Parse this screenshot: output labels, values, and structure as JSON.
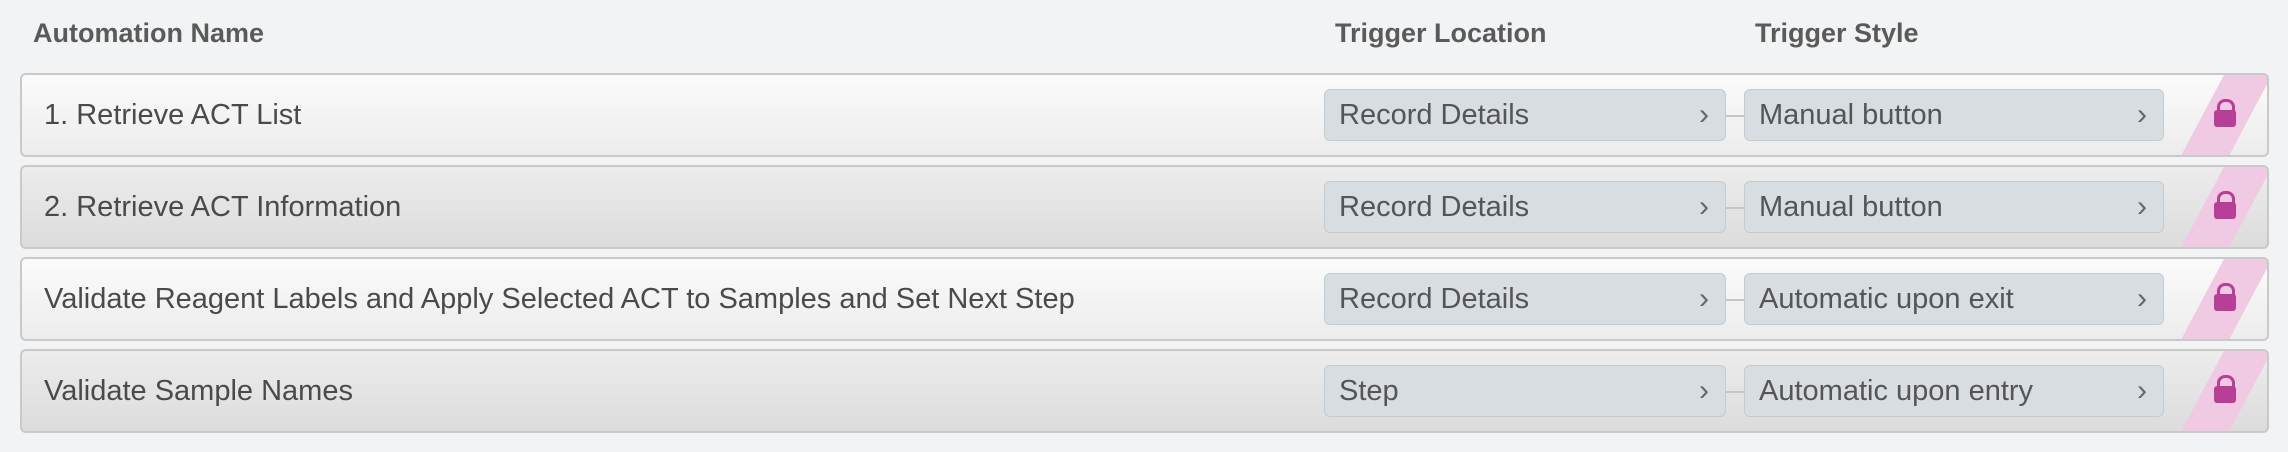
{
  "header": {
    "name": "Automation Name",
    "location": "Trigger Location",
    "style": "Trigger Style"
  },
  "rows": [
    {
      "name": "1. Retrieve ACT List",
      "location": "Record Details",
      "style": "Manual button"
    },
    {
      "name": "2. Retrieve ACT Information",
      "location": "Record Details",
      "style": "Manual button"
    },
    {
      "name": "Validate Reagent Labels and Apply Selected ACT to Samples and Set Next Step",
      "location": "Record Details",
      "style": "Automatic upon exit"
    },
    {
      "name": "Validate Sample Names",
      "location": "Step",
      "style": "Automatic upon entry"
    }
  ],
  "icons": {
    "chevron": "chevron-right-icon",
    "lock": "lock-icon"
  },
  "colors": {
    "lock": "#b73f95",
    "lock_stripe": "#f0c9e3",
    "pill": "#d7dde1"
  }
}
